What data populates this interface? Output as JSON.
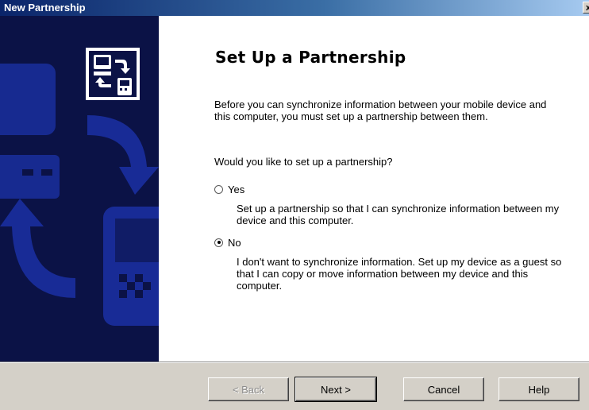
{
  "window": {
    "title": "New Partnership",
    "close_label": "x"
  },
  "main": {
    "heading": "Set Up a Partnership",
    "intro": "Before you can synchronize information between your mobile device and this computer, you must set up a partnership between them.",
    "question": "Would you like to set up a partnership?",
    "options": [
      {
        "label": "Yes",
        "selected": false,
        "description": "Set up a partnership so that I can synchronize information between my device and this computer."
      },
      {
        "label": "No",
        "selected": true,
        "description": "I don't want to synchronize information. Set up my device as a guest so that I can copy or move information between my device and this computer."
      }
    ]
  },
  "buttons": {
    "back": "< Back",
    "next": "Next >",
    "cancel": "Cancel",
    "help": "Help"
  },
  "banner": {
    "icon": "partnership-sync-icon",
    "accent": "#1a2f9e",
    "background": "#0b1246"
  }
}
